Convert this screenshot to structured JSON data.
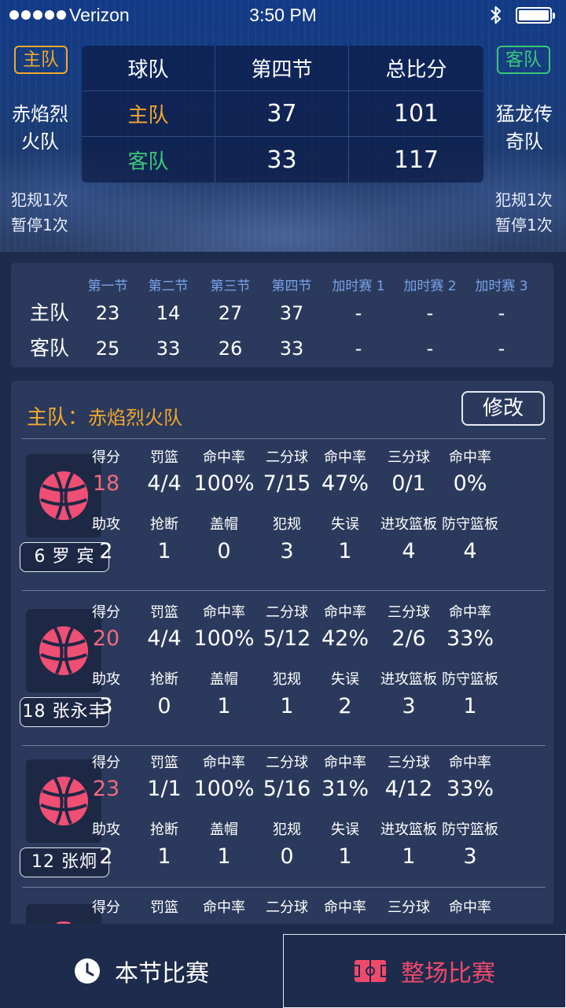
{
  "status_bar": {
    "carrier": "Verizon",
    "time": "3:50 PM"
  },
  "header": {
    "home_tag": "主队",
    "away_tag": "客队",
    "home_team": [
      "赤焰烈",
      "火队"
    ],
    "away_team": [
      "猛龙传",
      "奇队"
    ],
    "home_fouls": "犯规1次",
    "home_timeouts": "暂停1次",
    "away_fouls": "犯规1次",
    "away_timeouts": "暂停1次",
    "scoreboard": {
      "headers": [
        "球队",
        "第四节",
        "总比分"
      ],
      "rows": [
        {
          "team": "主队",
          "quarter": "37",
          "total": "101"
        },
        {
          "team": "客队",
          "quarter": "33",
          "total": "117"
        }
      ]
    }
  },
  "quarter_scores": {
    "headers": [
      "第一节",
      "第二节",
      "第三节",
      "第四节",
      "加时赛 1",
      "加时赛 2",
      "加时赛 3"
    ],
    "rows": [
      {
        "label": "主队",
        "values": [
          "23",
          "14",
          "27",
          "37",
          "-",
          "-",
          "-"
        ]
      },
      {
        "label": "客队",
        "values": [
          "25",
          "33",
          "26",
          "33",
          "-",
          "-",
          "-"
        ]
      }
    ]
  },
  "player_panel": {
    "team_label": "主队：",
    "team_name": "赤焰烈火队",
    "edit_label": "修改",
    "stat_labels_row1": [
      "得分",
      "罚篮",
      "命中率",
      "二分球",
      "命中率",
      "三分球",
      "命中率"
    ],
    "stat_labels_row2": [
      "助攻",
      "抢断",
      "盖帽",
      "犯规",
      "失误",
      "进攻篮板",
      "防守篮板"
    ],
    "players": [
      {
        "name": "6 罗 宾",
        "row1": [
          "18",
          "4/4",
          "100%",
          "7/15",
          "47%",
          "0/1",
          "0%"
        ],
        "row2": [
          "2",
          "1",
          "0",
          "3",
          "1",
          "4",
          "4"
        ]
      },
      {
        "name": "18 张永丰",
        "row1": [
          "20",
          "4/4",
          "100%",
          "5/12",
          "42%",
          "2/6",
          "33%"
        ],
        "row2": [
          "3",
          "0",
          "1",
          "1",
          "2",
          "3",
          "1"
        ]
      },
      {
        "name": "12 张炯",
        "row1": [
          "23",
          "1/1",
          "100%",
          "5/16",
          "31%",
          "4/12",
          "33%"
        ],
        "row2": [
          "2",
          "1",
          "1",
          "0",
          "1",
          "1",
          "3"
        ]
      },
      {
        "name": "",
        "row1": [],
        "row2": []
      }
    ]
  },
  "tabbar": {
    "tab1": "本节比赛",
    "tab2": "整场比赛"
  },
  "colors": {
    "home": "#f2a82b",
    "away": "#39c97a",
    "points": "#ef6b7e",
    "accent_tab": "#ef4a6b"
  }
}
